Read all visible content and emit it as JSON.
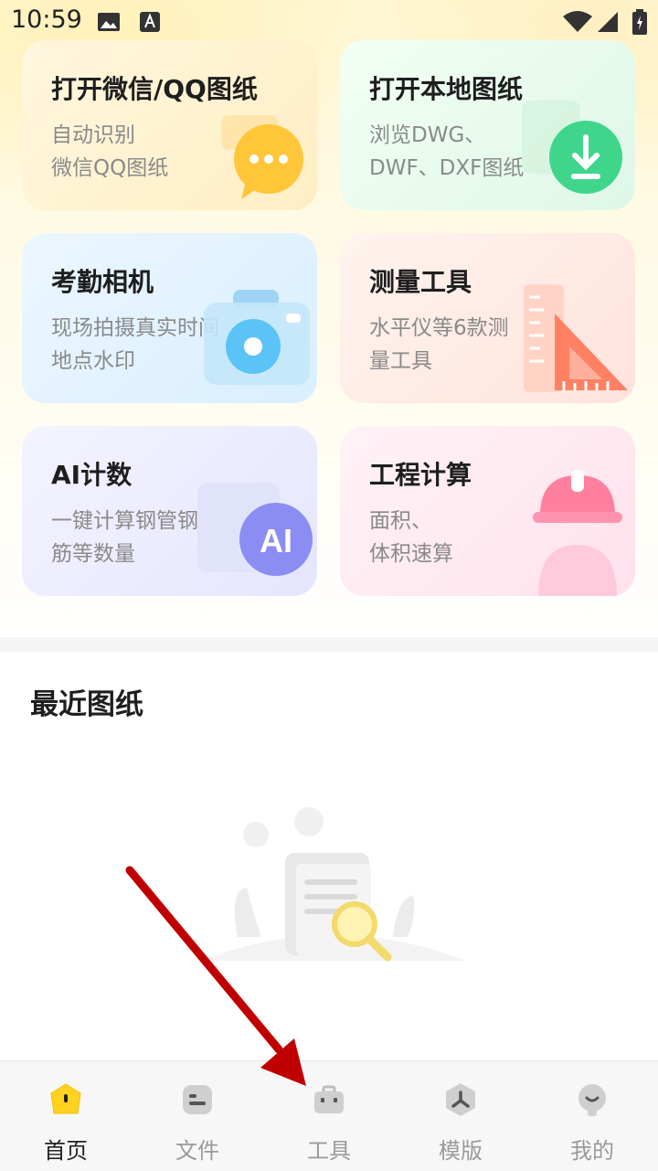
{
  "status_bar": {
    "time": "10:59"
  },
  "cards": [
    {
      "title": "打开微信/QQ图纸",
      "desc": [
        "自动识别",
        "微信QQ图纸"
      ]
    },
    {
      "title": "打开本地图纸",
      "desc": [
        "浏览DWG、",
        "DWF、DXF图纸"
      ]
    },
    {
      "title": "考勤相机",
      "desc": [
        "现场拍摄真实时间",
        "地点水印"
      ]
    },
    {
      "title": "测量工具",
      "desc": [
        "水平仪等6款测",
        "量工具"
      ]
    },
    {
      "title": "AI计数",
      "desc": [
        "一键计算钢管钢",
        "筋等数量"
      ],
      "art_text": "AI"
    },
    {
      "title": "工程计算",
      "desc": [
        "面积、",
        "体积速算"
      ]
    }
  ],
  "recent": {
    "title": "最近图纸"
  },
  "nav": [
    {
      "label": "首页",
      "active": true
    },
    {
      "label": "文件"
    },
    {
      "label": "工具"
    },
    {
      "label": "模版"
    },
    {
      "label": "我的"
    }
  ],
  "colors": {
    "accent": "#FFD21F",
    "arrow": "#C00000"
  }
}
